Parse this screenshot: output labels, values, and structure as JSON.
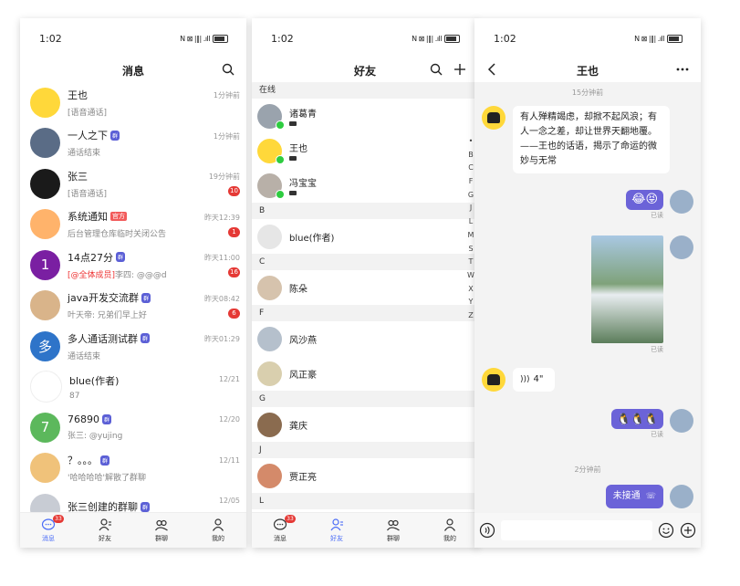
{
  "status": {
    "time": "1:02"
  },
  "messages_screen": {
    "title": "消息",
    "items": [
      {
        "name": "王也",
        "preview": "[语音通话]",
        "time": "1分钟前",
        "avatar_color": "#ffd83a",
        "avatar_text": ""
      },
      {
        "name": "一人之下",
        "tag": "群",
        "preview": "通话结束",
        "time": "1分钟前",
        "avatar_color": "#5a6c86",
        "avatar_text": ""
      },
      {
        "name": "张三",
        "preview": "[语音通话]",
        "time": "19分钟前",
        "unread": "10",
        "avatar_color": "#1a1a1a",
        "avatar_text": ""
      },
      {
        "name": "系统通知",
        "tag_official": "官方",
        "preview": "后台管理仓库临时关闭公告",
        "time": "昨天12:39",
        "unread": "1",
        "avatar_color": "#ffb36b",
        "avatar_text": ""
      },
      {
        "name": "14点27分",
        "tag": "群",
        "preview_mention": "[@全体成员]",
        "preview": "李四: @@@d",
        "time": "昨天11:00",
        "unread": "16",
        "avatar_color": "#7a1fa2",
        "avatar_text": "1"
      },
      {
        "name": "java开发交流群",
        "tag": "群",
        "preview": "叶天帝: 兄弟们早上好",
        "time": "昨天08:42",
        "unread": "6",
        "avatar_color": "#d9b48a",
        "avatar_text": ""
      },
      {
        "name": "多人通话测试群",
        "tag": "群",
        "preview": "通话结束",
        "time": "昨天01:29",
        "avatar_color": "#2e74c9",
        "avatar_text": "多"
      },
      {
        "name": "blue(作者)",
        "preview": "87",
        "time": "12/21",
        "avatar_color": "#ffffff",
        "avatar_text": ""
      },
      {
        "name": "76890",
        "tag": "群",
        "preview": "张三: @yujing",
        "time": "12/20",
        "avatar_color": "#5cb85c",
        "avatar_text": "7"
      },
      {
        "name": "？。。。",
        "tag": "群",
        "preview": "'哈哈哈哈'解散了群聊",
        "time": "12/11",
        "avatar_color": "#f0c27a",
        "avatar_text": ""
      },
      {
        "name": "张三创建的群聊",
        "tag": "群",
        "preview": "",
        "time": "12/05",
        "avatar_color": "#c8ccd4",
        "avatar_text": ""
      }
    ]
  },
  "tabs": [
    {
      "label": "消息",
      "icon": "chat-icon"
    },
    {
      "label": "好友",
      "icon": "contacts-icon"
    },
    {
      "label": "群聊",
      "icon": "group-icon"
    },
    {
      "label": "我的",
      "icon": "person-icon"
    }
  ],
  "tab_badge": "33",
  "friends_screen": {
    "title": "好友",
    "online_label": "在线",
    "online": [
      {
        "name": "诸葛青",
        "avatar_color": "#9aa3ad"
      },
      {
        "name": "王也",
        "avatar_color": "#ffd83a"
      },
      {
        "name": "冯宝宝",
        "avatar_color": "#b8b0a8"
      }
    ],
    "sections": [
      {
        "letter": "B",
        "friends": [
          "blue(作者)"
        ]
      },
      {
        "letter": "C",
        "friends": [
          "陈朵"
        ]
      },
      {
        "letter": "F",
        "friends": [
          "风沙燕",
          "风正豪"
        ]
      },
      {
        "letter": "G",
        "friends": [
          "龚庆"
        ]
      },
      {
        "letter": "J",
        "friends": [
          "贾正亮"
        ]
      },
      {
        "letter": "L",
        "friends": []
      }
    ],
    "alphabet": [
      "•",
      "B",
      "C",
      "F",
      "G",
      "J",
      "L",
      "M",
      "S",
      "T",
      "W",
      "X",
      "Y",
      "Z"
    ]
  },
  "chat_screen": {
    "title": "王也",
    "time_1": "15分钟前",
    "msg_1": "有人殚精竭虑，却掀不起风浪；有人一念之差，却让世界天翻地覆。——王也的话语，揭示了命运的微妙与无常",
    "emoji_msg": "😂😝",
    "read_1": "已读",
    "read_2": "已读",
    "voice_msg": "4\"",
    "sticker_msg": "🐧🐧🐧",
    "read_3": "已读",
    "time_2": "2分钟前",
    "call_msg": "未接通"
  }
}
